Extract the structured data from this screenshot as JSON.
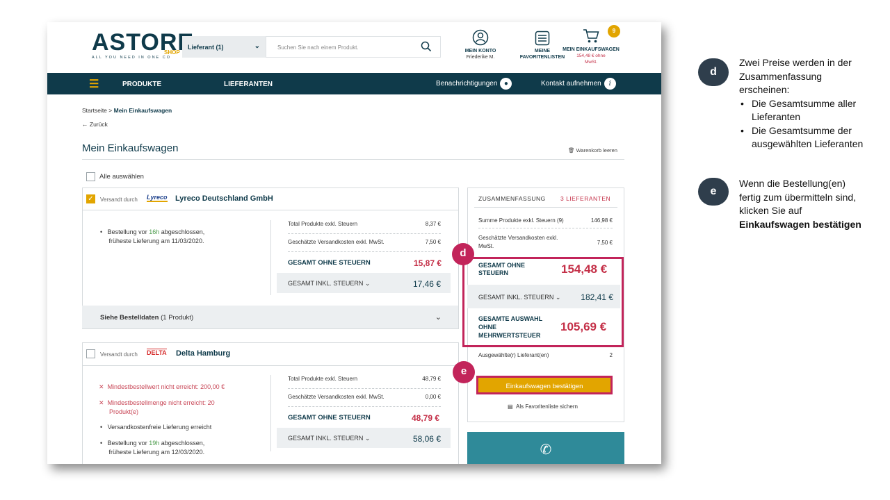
{
  "header": {
    "logo_text": "ASTORE",
    "logo_shop": "SHOP",
    "logo_tagline": "ALL YOU NEED IN ONE CO",
    "supplier_select": "Lieferant (1)",
    "search_placeholder": "Suchen Sie nach einem Produkt.",
    "account_label": "MEIN KONTO",
    "account_name": "Friederike M.",
    "favorites_label_1": "MEINE",
    "favorites_label_2": "FAVORITENLISTEN",
    "cart_label": "MEIN EINKAUFSWAGEN",
    "cart_total": "154,48 € ohne",
    "cart_total_2": "MwSt.",
    "cart_count": "9"
  },
  "nav": {
    "products": "PRODUKTE",
    "suppliers": "LIEFERANTEN",
    "notifications": "Benachrichtigungen",
    "contact": "Kontakt aufnehmen"
  },
  "breadcrumb": {
    "home": "Startseite",
    "sep": ">",
    "current": "Mein Einkaufswagen"
  },
  "back": "Zurück",
  "page_title": "Mein Einkaufswagen",
  "empty_cart": "Warenkorb leeren",
  "select_all": "Alle auswählen",
  "suppliers": [
    {
      "shipped_by": "Versandt durch",
      "logo": "Lyreco",
      "name": "Lyreco Deutschland GmbH",
      "notes": [
        "Bestellung vor ",
        "16h",
        " abgeschlossen,",
        "früheste Lieferung am 11/03/2020."
      ],
      "total_products_label": "Total Produkte exkl. Steuern",
      "total_products": "8,37 €",
      "shipping_label": "Geschätzte Versandkosten exkl. MwSt.",
      "shipping": "7,50 €",
      "total_excl_label": "GESAMT OHNE STEUERN",
      "total_excl": "15,87 €",
      "total_incl_label": "GESAMT INKL. STEUERN",
      "total_incl": "17,46 €",
      "details_label": "Siehe Bestelldaten",
      "details_count": "(1 Produkt)"
    },
    {
      "shipped_by": "Versandt durch",
      "logo": "DELTA",
      "name": "Delta Hamburg",
      "err1": "Mindestbestellwert nicht erreicht: 200,00 €",
      "err2a": "Mindestbestellmenge nicht erreicht: 20",
      "err2b": "Produkt(e)",
      "ok1": "Versandkostenfreie Lieferung erreicht",
      "ok2": [
        "Bestellung vor ",
        "19h",
        " abgeschlossen,",
        "früheste Lieferung am 12/03/2020."
      ],
      "total_products_label": "Total Produkte exkl. Steuern",
      "total_products": "48,79 €",
      "shipping_label": "Geschätzte Versandkosten exkl. MwSt.",
      "shipping": "0,00 €",
      "total_excl_label": "GESAMT OHNE STEUERN",
      "total_excl": "48,79 €",
      "total_incl_label": "GESAMT INKL. STEUERN",
      "total_incl": "58,06 €"
    }
  ],
  "summary": {
    "title": "ZUSAMMENFASSUNG",
    "supplier_count": "3 LIEFERANTEN",
    "sum_products_label": "Summe Produkte exkl. Steuern (9)",
    "sum_products": "146,98 €",
    "shipping_label_1": "Geschätzte Versandkosten exkl.",
    "shipping_label_2": "MwSt.",
    "shipping": "7,50 €",
    "total_excl_label_1": "GESAMT OHNE",
    "total_excl_label_2": "STEUERN",
    "total_excl": "154,48 €",
    "total_incl_label": "GESAMT INKL. STEUERN",
    "total_incl": "182,41 €",
    "selection_label_1": "GESAMTE AUSWAHL",
    "selection_label_2": "OHNE",
    "selection_label_3": "MEHRWERTSTEUER",
    "selection_total": "105,69 €",
    "selected_suppliers_label": "Ausgewählte(r) Lieferant(en)",
    "selected_suppliers": "2",
    "confirm_button": "Einkaufswagen bestätigen",
    "save_favorites": "Als Favoritenliste sichern"
  },
  "markers": {
    "d": "d",
    "e": "e"
  },
  "notes": {
    "d_intro_1": "Zwei Preise werden in der",
    "d_intro_2": "Zusammenfassung",
    "d_intro_3": "erscheinen:",
    "d_bullet_1a": "Die Gesamtsumme  aller",
    "d_bullet_1b": "Lieferanten",
    "d_bullet_2a": "Die Gesamtsumme  der",
    "d_bullet_2b": "ausgewählten  Lieferanten",
    "e_text_1": "Wenn die Bestellung(en)",
    "e_text_2": "fertig zum  übermitteln sind,",
    "e_text_3": "klicken Sie auf",
    "e_text_bold": "Einkaufswagen bestätigen"
  },
  "colors": {
    "navy": "#0f3a4a",
    "accent": "#e2a500",
    "price_red": "#c42f47",
    "highlight": "#c2245a",
    "teal": "#2f8a99"
  }
}
